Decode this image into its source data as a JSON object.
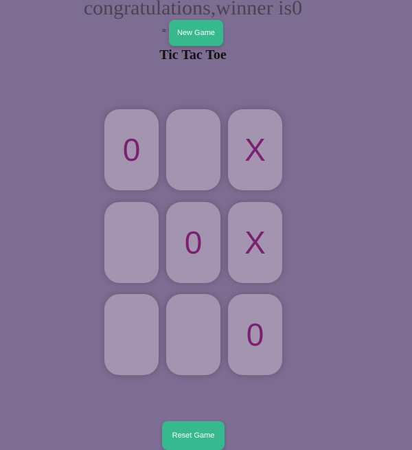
{
  "status": {
    "winner_message": "congratulations,winner is0",
    "separator": "="
  },
  "buttons": {
    "new_game": "New Game",
    "reset_game": "Reset Game"
  },
  "game": {
    "title": "Tic Tac Toe",
    "board": [
      "0",
      "",
      "X",
      "",
      "0",
      "X",
      "",
      "",
      "0"
    ]
  },
  "colors": {
    "background": "#7e6d93",
    "button": "#36b98f",
    "cell": "#a394b0",
    "mark": "#7c1f6e",
    "message": "#494452"
  }
}
